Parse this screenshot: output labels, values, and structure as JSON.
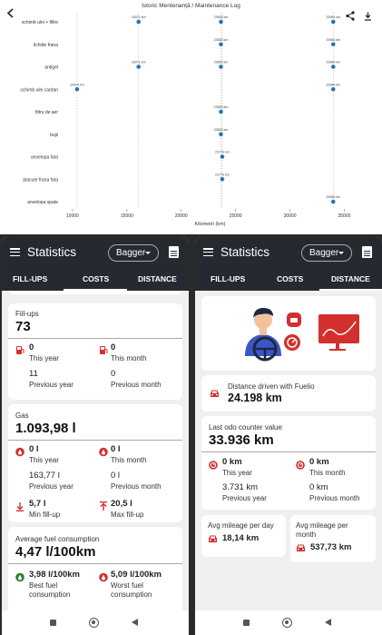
{
  "chart": {
    "title": "Istoric Mentenanță / Maintenance Log",
    "xlabel": "Kilometri (km)",
    "x_ticks": [
      "10000",
      "15000",
      "20000",
      "25000",
      "30000",
      "35000"
    ]
  },
  "chart_data": {
    "type": "scatter",
    "title": "Istoric Mentenanță / Maintenance Log",
    "xlabel": "Kilometri (km)",
    "xlim": [
      9000,
      36300
    ],
    "categories": [
      "schimb ulei + filtre",
      "lichide frana",
      "antigel",
      "schimb ulei cardan",
      "filtru de aer",
      "bujii",
      "anvelopa fata",
      "placute frana fata",
      "anvelopa spate"
    ],
    "series": [
      {
        "category": "schimb ulei + filtre",
        "points": [
          16071,
          23653,
          33984
        ],
        "labels": [
          "16071 km",
          "23653 km",
          "33984 km"
        ]
      },
      {
        "category": "lichide frana",
        "points": [
          23653,
          33984
        ],
        "labels": [
          "23653 km",
          "33984 km"
        ]
      },
      {
        "category": "antigel",
        "points": [
          16071,
          23653,
          33984
        ],
        "labels": [
          "16071 km",
          "23653 km",
          "33984 km"
        ]
      },
      {
        "category": "schimb ulei cardan",
        "points": [
          10414,
          33984
        ],
        "labels": [
          "10414 km",
          "33984 km"
        ]
      },
      {
        "category": "filtru de aer",
        "points": [
          23653
        ],
        "labels": [
          "23653 km"
        ]
      },
      {
        "category": "bujii",
        "points": [
          23653
        ],
        "labels": [
          "23653 km"
        ]
      },
      {
        "category": "anvelopa fata",
        "points": [
          23773
        ],
        "labels": [
          "23773 km"
        ]
      },
      {
        "category": "placute frana fata",
        "points": [
          23773
        ],
        "labels": [
          "23773 km"
        ]
      },
      {
        "category": "anvelopa spate",
        "points": [
          33984
        ],
        "labels": [
          "33984 km"
        ]
      }
    ],
    "point_color": "#1f77b4"
  },
  "common": {
    "app_title": "Statistics",
    "vehicle": "Bagger",
    "icons": {
      "menu": "menu-icon",
      "report": "report-icon",
      "dropdown": "chevron-down-icon"
    },
    "tabs": [
      "FILL-UPS",
      "COSTS",
      "DISTANCE"
    ]
  },
  "left": {
    "active_tab": "COSTS",
    "fillups": {
      "label": "Fill-ups",
      "value": "73",
      "this_year": "0",
      "this_year_label": "This year",
      "this_month": "0",
      "this_month_label": "This month",
      "prev_year": "11",
      "prev_year_label": "Previous year",
      "prev_month": "0",
      "prev_month_label": "Previous month"
    },
    "gas": {
      "label": "Gas",
      "value": "1.093,98 l",
      "this_year": "0 l",
      "this_year_label": "This year",
      "this_month": "0 l",
      "this_month_label": "This month",
      "prev_year": "163,77 l",
      "prev_year_label": "Previous year",
      "prev_month": "0 l",
      "prev_month_label": "Previous month",
      "min_fill": "5,7 l",
      "min_fill_label": "Min fill-up",
      "max_fill": "20,5 l",
      "max_fill_label": "Max fill-up"
    },
    "consumption": {
      "label": "Average fuel consumption",
      "value": "4,47 l/100km",
      "best": "3,98 l/100km",
      "best_label_1": "Best fuel",
      "best_label_2": "consumption",
      "worst": "5,09 l/100km",
      "worst_label_1": "Worst fuel",
      "worst_label_2": "consumption"
    }
  },
  "right": {
    "active_tab": "DISTANCE",
    "driven": {
      "label": "Distance driven with Fuelio",
      "value": "24.198 km"
    },
    "odo": {
      "label": "Last odo counter value",
      "value": "33.936 km",
      "this_year": "0 km",
      "this_year_label": "This year",
      "this_month": "0 km",
      "this_month_label": "This month",
      "prev_year": "3.731 km",
      "prev_year_label": "Previous year",
      "prev_month": "0 km",
      "prev_month_label": "Previous month"
    },
    "per_day": {
      "label": "Avg mileage per day",
      "value": "18,14 km"
    },
    "per_month": {
      "label_1": "Avg mileage per",
      "label_2": "month",
      "value": "537,73 km"
    }
  },
  "colors": {
    "accent": "#d32f2f",
    "appbar": "#252a30",
    "green": "#2e7d32",
    "chart_point": "#1f77b4"
  }
}
